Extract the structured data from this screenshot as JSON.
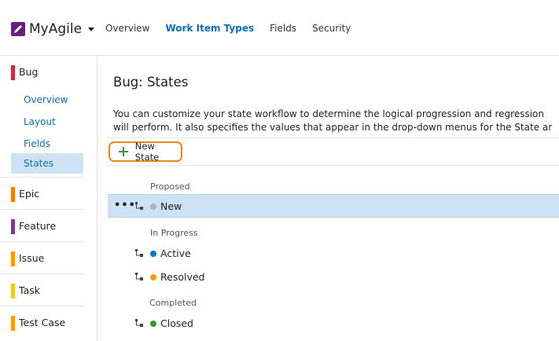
{
  "app": {
    "name": "MyAgile"
  },
  "nav": {
    "items": [
      "Overview",
      "Work Item Types",
      "Fields",
      "Security"
    ],
    "active": "Work Item Types"
  },
  "sidebar": {
    "selected_type": {
      "label": "Bug",
      "color": "#cc293d",
      "sub_items": [
        "Overview",
        "Layout",
        "Fields",
        "States"
      ],
      "selected_sub": "States"
    },
    "types": [
      {
        "label": "Epic",
        "color": "#ff7b00"
      },
      {
        "label": "Feature",
        "color": "#773b93"
      },
      {
        "label": "Issue",
        "color": "#ff9d00"
      },
      {
        "label": "Task",
        "color": "#f2cb1d"
      },
      {
        "label": "Test Case",
        "color": "#ff9d00"
      }
    ]
  },
  "main": {
    "title": "Bug: States",
    "description": [
      "You can customize your state workflow to determine the logical progression and regression",
      "will perform. It also specifies the values that appear in the drop-down menus for the State ar"
    ],
    "toolbar": {
      "new_state_label": "New State"
    },
    "categories": [
      {
        "label": "Proposed",
        "states": [
          {
            "label": "New",
            "color": "#b2b2b2",
            "selected": true
          }
        ]
      },
      {
        "label": "In Progress",
        "states": [
          {
            "label": "Active",
            "color": "#007acc"
          },
          {
            "label": "Resolved",
            "color": "#ff9d00"
          }
        ]
      },
      {
        "label": "Completed",
        "states": [
          {
            "label": "Closed",
            "color": "#339933"
          }
        ]
      }
    ],
    "row_more_glyph": "•••"
  }
}
